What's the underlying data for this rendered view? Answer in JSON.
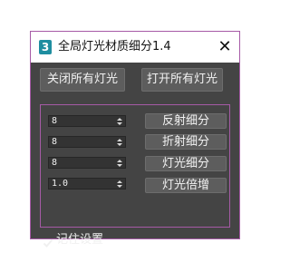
{
  "window": {
    "title": "全局灯光材质细分1.4",
    "app_icon_glyph": "3",
    "close_glyph": "✕"
  },
  "top_buttons": {
    "close_all_lights": "关闭所有灯光",
    "open_all_lights": "打开所有灯光"
  },
  "rows": [
    {
      "value": "8",
      "button": "反射细分"
    },
    {
      "value": "8",
      "button": "折射细分"
    },
    {
      "value": "8",
      "button": "灯光细分"
    },
    {
      "value": "1.0",
      "button": "灯光倍增"
    }
  ],
  "remember": {
    "label": "记住设置",
    "checked": true
  },
  "colors": {
    "panel_bg": "#444444",
    "border_accent": "#a65aa6",
    "button_bg": "#5d5d5d",
    "icon_teal": "#1f8ea0"
  },
  "icons": {
    "app": "3dsmax-icon",
    "close": "close-icon",
    "spinner": "spinner-arrows-icon",
    "check": "checkmark-icon"
  }
}
